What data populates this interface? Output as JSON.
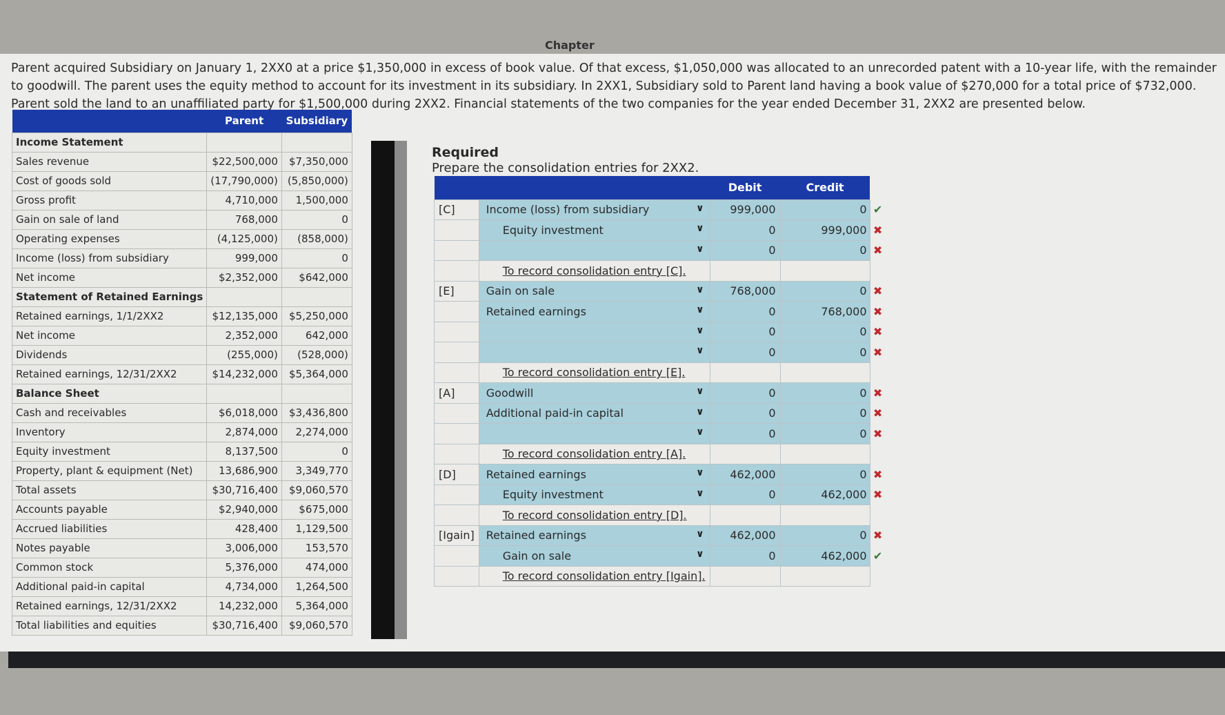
{
  "header": {
    "chapter": "Chapter"
  },
  "problem": {
    "text": "Parent acquired Subsidiary on January 1, 2XX0 at a price $1,350,000 in excess of book value. Of that excess, $1,050,000 was allocated to an unrecorded patent with a 10-year life, with the remainder to goodwill. The parent uses the equity method to account for its investment in its subsidiary. In 2XX1, Subsidiary sold to Parent land having a book value of $270,000 for a total price of $732,000. Parent sold the land to an unaffiliated party for $1,500,000 during 2XX2. Financial statements of the two companies for the year ended December 31, 2XX2 are presented below."
  },
  "financials": {
    "columns": [
      "Parent",
      "Subsidiary"
    ],
    "rows": [
      {
        "label": "Income Statement",
        "section": true,
        "parent": "",
        "sub": ""
      },
      {
        "label": "Sales revenue",
        "parent": "$22,500,000",
        "sub": "$7,350,000"
      },
      {
        "label": "Cost of goods sold",
        "parent": "(17,790,000)",
        "sub": "(5,850,000)"
      },
      {
        "label": "Gross profit",
        "parent": "4,710,000",
        "sub": "1,500,000"
      },
      {
        "label": "Gain on sale of land",
        "parent": "768,000",
        "sub": "0"
      },
      {
        "label": "Operating expenses",
        "parent": "(4,125,000)",
        "sub": "(858,000)"
      },
      {
        "label": "Income (loss) from subsidiary",
        "parent": "999,000",
        "sub": "0"
      },
      {
        "label": "Net income",
        "parent": "$2,352,000",
        "sub": "$642,000"
      },
      {
        "label": "Statement of Retained Earnings",
        "section": true,
        "parent": "",
        "sub": ""
      },
      {
        "label": "Retained earnings, 1/1/2XX2",
        "parent": "$12,135,000",
        "sub": "$5,250,000"
      },
      {
        "label": "Net income",
        "parent": "2,352,000",
        "sub": "642,000"
      },
      {
        "label": "Dividends",
        "parent": "(255,000)",
        "sub": "(528,000)"
      },
      {
        "label": "Retained earnings, 12/31/2XX2",
        "parent": "$14,232,000",
        "sub": "$5,364,000"
      },
      {
        "label": "Balance Sheet",
        "section": true,
        "parent": "",
        "sub": ""
      },
      {
        "label": "Cash and receivables",
        "parent": "$6,018,000",
        "sub": "$3,436,800"
      },
      {
        "label": "Inventory",
        "parent": "2,874,000",
        "sub": "2,274,000"
      },
      {
        "label": "Equity investment",
        "parent": "8,137,500",
        "sub": "0"
      },
      {
        "label": "Property, plant & equipment (Net)",
        "parent": "13,686,900",
        "sub": "3,349,770"
      },
      {
        "label": "Total assets",
        "parent": "$30,716,400",
        "sub": "$9,060,570"
      },
      {
        "label": "Accounts payable",
        "parent": "$2,940,000",
        "sub": "$675,000"
      },
      {
        "label": "Accrued liabilities",
        "parent": "428,400",
        "sub": "1,129,500"
      },
      {
        "label": "Notes payable",
        "parent": "3,006,000",
        "sub": "153,570"
      },
      {
        "label": "Common stock",
        "parent": "5,376,000",
        "sub": "474,000"
      },
      {
        "label": "Additional paid-in capital",
        "parent": "4,734,000",
        "sub": "1,264,500"
      },
      {
        "label": "Retained earnings, 12/31/2XX2",
        "parent": "14,232,000",
        "sub": "5,364,000"
      },
      {
        "label": "Total liabilities and equities",
        "parent": "$30,716,400",
        "sub": "$9,060,570"
      }
    ]
  },
  "required": {
    "title": "Required",
    "instruction": "Prepare the consolidation entries for 2XX2."
  },
  "consolidation": {
    "columns": [
      "Debit",
      "Credit"
    ],
    "status_colors": {
      "correct": "#3b7a3b",
      "incorrect": "#c0282d"
    },
    "entries": [
      {
        "code": "[C]",
        "lines": [
          {
            "account": "Income (loss) from subsidiary",
            "indent": false,
            "debit": "999,000",
            "credit": "0",
            "status": "correct"
          },
          {
            "account": "Equity investment",
            "indent": true,
            "debit": "0",
            "credit": "999,000",
            "status": "incorrect"
          },
          {
            "account": "",
            "indent": false,
            "debit": "0",
            "credit": "0",
            "status": "incorrect"
          }
        ],
        "memo": "To record consolidation entry [C]."
      },
      {
        "code": "[E]",
        "lines": [
          {
            "account": "Gain on sale",
            "indent": false,
            "debit": "768,000",
            "credit": "0",
            "status": "incorrect"
          },
          {
            "account": "Retained earnings",
            "indent": false,
            "debit": "0",
            "credit": "768,000",
            "status": "incorrect"
          },
          {
            "account": "",
            "indent": false,
            "debit": "0",
            "credit": "0",
            "status": "incorrect"
          },
          {
            "account": "",
            "indent": false,
            "debit": "0",
            "credit": "0",
            "status": "incorrect"
          }
        ],
        "memo": "To record consolidation entry [E]."
      },
      {
        "code": "[A]",
        "lines": [
          {
            "account": "Goodwill",
            "indent": false,
            "debit": "0",
            "credit": "0",
            "status": "incorrect"
          },
          {
            "account": "Additional paid-in capital",
            "indent": false,
            "debit": "0",
            "credit": "0",
            "status": "incorrect"
          },
          {
            "account": "",
            "indent": false,
            "debit": "0",
            "credit": "0",
            "status": "incorrect"
          }
        ],
        "memo": "To record consolidation entry [A]."
      },
      {
        "code": "[D]",
        "lines": [
          {
            "account": "Retained earnings",
            "indent": false,
            "debit": "462,000",
            "credit": "0",
            "status": "incorrect"
          },
          {
            "account": "Equity investment",
            "indent": true,
            "debit": "0",
            "credit": "462,000",
            "status": "incorrect"
          }
        ],
        "memo": "To record consolidation entry [D]."
      },
      {
        "code": "[Igain]",
        "lines": [
          {
            "account": "Retained earnings",
            "indent": false,
            "debit": "462,000",
            "credit": "0",
            "status": "incorrect"
          },
          {
            "account": "Gain on sale",
            "indent": true,
            "debit": "0",
            "credit": "462,000",
            "status": "correct"
          }
        ],
        "memo": "To record consolidation entry [Igain]."
      }
    ]
  },
  "icons": {
    "dropdown": "chevron-down-icon",
    "correct": "check-icon",
    "incorrect": "x-icon"
  }
}
